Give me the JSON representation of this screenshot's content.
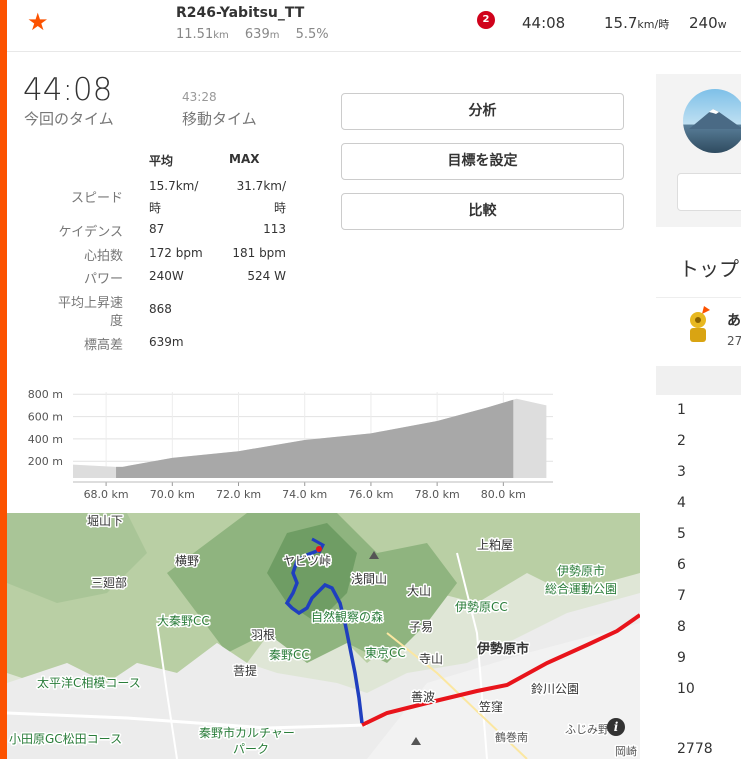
{
  "brand_color": "#fc5200",
  "header": {
    "star_icon": "star-icon",
    "segment_name": "R246-Yabitsu_TT",
    "distance": "11.51",
    "distance_unit": "km",
    "elevation": "639",
    "elevation_unit": "m",
    "grade": "5.5%",
    "rank_badge": "2",
    "time": "44:08",
    "speed": "15.7",
    "speed_unit": "km/時",
    "power": "240",
    "power_unit": "w"
  },
  "effort": {
    "time": "44:08",
    "time_label": "今回のタイム",
    "moving_time": "43:28",
    "moving_time_label": "移動タイム"
  },
  "stats": {
    "avg_header": "平均",
    "max_header": "MAX",
    "rows": [
      {
        "label": "スピード",
        "avg": "15.7km/",
        "avg2": "時",
        "max": "31.7km/",
        "max2": "時"
      },
      {
        "label": "ケイデンス",
        "avg": "87",
        "max": "113"
      },
      {
        "label": "心拍数",
        "avg": "172 bpm",
        "max": "181 bpm"
      },
      {
        "label": "パワー",
        "avg": "240W",
        "max": "524 W"
      },
      {
        "label": "平均上昇速",
        "label2": "度",
        "avg": "868",
        "max": ""
      },
      {
        "label": "標高差",
        "avg": "639m",
        "max": ""
      }
    ]
  },
  "actions": {
    "analysis": "分析",
    "set_goal": "目標を設定",
    "compare": "比較"
  },
  "leaderboard": {
    "heading": "トップ",
    "leader_name": "あ",
    "leader_sub": "27",
    "ranks": [
      "1",
      "2",
      "3",
      "4",
      "5",
      "6",
      "7",
      "8",
      "9",
      "10"
    ],
    "total": "2778"
  },
  "chart_data": {
    "type": "area",
    "title": "",
    "xlabel": "",
    "ylabel": "",
    "x_ticks": [
      "68.0 km",
      "70.0 km",
      "72.0 km",
      "74.0 km",
      "76.0 km",
      "78.0 km",
      "80.0 km"
    ],
    "y_ticks": [
      "200 m",
      "400 m",
      "600 m",
      "800 m"
    ],
    "xlim": [
      67.0,
      81.5
    ],
    "ylim": [
      50,
      820
    ],
    "series": [
      {
        "x": [
          67.0,
          68.3,
          68.5,
          70.0,
          72.0,
          74.0,
          76.0,
          78.0,
          79.5,
          80.4,
          81.3
        ],
        "y": [
          170,
          150,
          150,
          230,
          290,
          390,
          450,
          560,
          680,
          760,
          700
        ]
      }
    ],
    "segment_range": [
      68.3,
      80.3
    ],
    "grid": true
  },
  "map": {
    "labels": {
      "horiyamashita": "堀山下",
      "yokono": "横野",
      "yabitsu_pass": "ヤビツ峠",
      "asamayama": "浅間山",
      "kamikasuya": "上粕屋",
      "sannosaburo": "三廻部",
      "oyama": "大山",
      "isehara_park": "伊勢原市",
      "isehara_park2": "総合運動公園",
      "oohadano_cc": "大秦野CC",
      "shizen_kansatsu": "自然観察の森",
      "isehara_cc": "伊勢原CC",
      "hane": "羽根",
      "koyasu": "子易",
      "hadano_cc": "秦野CC",
      "tokyo_cc": "東京CC",
      "teramaya": "寺山",
      "isehara_city": "伊勢原市",
      "bodai": "菩提",
      "taiheiyo_cc": "太平洋C相模コース",
      "zenba": "善波",
      "suzukawa_park": "鈴川公園",
      "kasakubo": "笠窪",
      "odawara_cc": "小田原GC松田コース",
      "hadano_culture": "秦野市カルチャー",
      "hadano_culture2": "パーク",
      "fujimino": "ふじみ野",
      "tsurumaki": "鶴巻南",
      "okaza": "岡崎"
    },
    "route_color": "#e8141b",
    "track_color": "#1f3fbf"
  }
}
